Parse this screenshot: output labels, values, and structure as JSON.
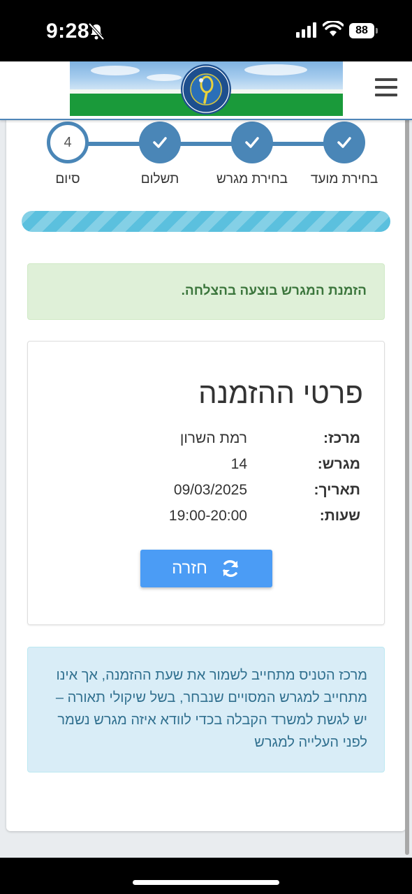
{
  "status_bar": {
    "time": "9:28",
    "battery": "88",
    "icons": [
      "bell-slash-icon",
      "signal-icon",
      "wifi-icon",
      "battery-icon"
    ]
  },
  "header": {
    "logo_icon": "tennis-racket-logo",
    "menu_icon": "hamburger-icon"
  },
  "stepper": {
    "steps": [
      {
        "label": "בחירת מועד",
        "state": "done"
      },
      {
        "label": "בחירת מגרש",
        "state": "done"
      },
      {
        "label": "תשלום",
        "state": "done"
      },
      {
        "label": "סיום",
        "state": "current",
        "number": "4"
      }
    ]
  },
  "progress": {
    "value": 1.0
  },
  "success_message": "הזמנת המגרש בוצעה בהצלחה.",
  "details": {
    "title": "פרטי ההזמנה",
    "rows": [
      {
        "label": "מרכז:",
        "value": "רמת השרון"
      },
      {
        "label": "מגרש:",
        "value": "14"
      },
      {
        "label": "תאריך:",
        "value": "09/03/2025"
      },
      {
        "label": "שעות:",
        "value": "19:00-20:00"
      }
    ],
    "return_button": "חזרה"
  },
  "info_message": "מרכז הטניס מתחייב לשמור את שעת ההזמנה, אך אינו מתחייב למגרש המסויים שנבחר, בשל שיקולי תאורה – יש לגשת למשרד הקבלה בכדי לוודא איזה מגרש נשמר לפני העלייה למגרש",
  "colors": {
    "primary": "#4a86b7",
    "button": "#4b9cf5",
    "success_bg": "#dff0d8",
    "success_text": "#3c763d",
    "info_bg": "#d9edf7",
    "info_text": "#31708f"
  }
}
